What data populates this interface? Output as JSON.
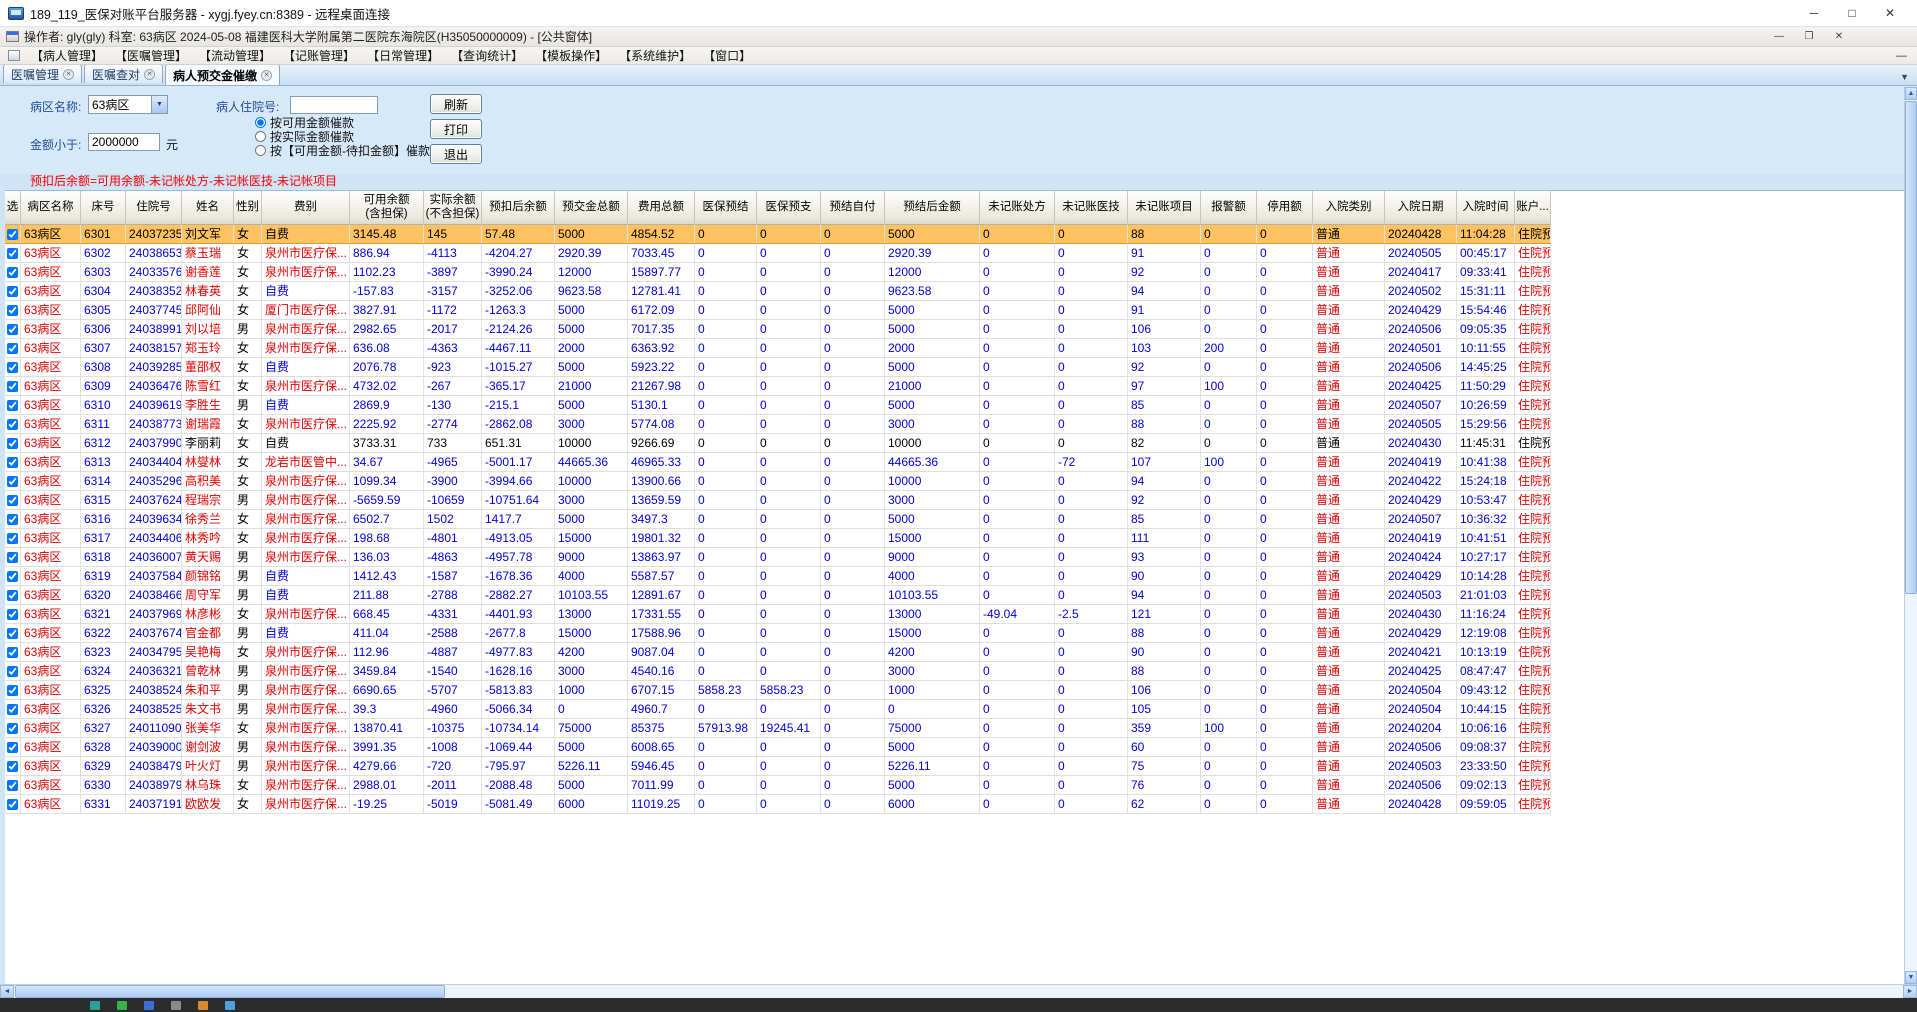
{
  "window": {
    "rdp_title": "189_119_医保对账平台服务器 - xygj.fyey.cn:8389 - 远程桌面连接",
    "app_title": "操作者: gly(gly)  科室: 63病区  2024-05-08  福建医科大学附属第二医院东海院区(H35050000009) - [公共窗体]"
  },
  "icons": {
    "minimize": "─",
    "maximize": "□",
    "close": "✕",
    "mdi_minimize": "—",
    "mdi_restore": "❐",
    "mdi_close": "✕",
    "dropdown_arrow": "▼",
    "tab_close": "✕",
    "tab_overflow": "▼",
    "scroll_up": "▲",
    "scroll_down": "▼",
    "scroll_left": "◄",
    "scroll_right": "►"
  },
  "menu": {
    "items": [
      "【病人管理】",
      "【医嘱管理】",
      "【流动管理】",
      "【记账管理】",
      "【日常管理】",
      "【查询统计】",
      "【模板操作】",
      "【系统维护】",
      "【窗口】"
    ]
  },
  "tabs": [
    {
      "label": "医嘱管理",
      "active": false
    },
    {
      "label": "医嘱查对",
      "active": false
    },
    {
      "label": "病人预交金催缴",
      "active": true
    }
  ],
  "filters": {
    "ward_label": "病区名称:",
    "ward_value": "63病区",
    "patient_label": "病人住院号:",
    "patient_value": "",
    "amount_label": "金额小于:",
    "amount_value": "2000000",
    "amount_unit": "元",
    "radios": [
      {
        "label": "按可用金额催款",
        "checked": true
      },
      {
        "label": "按实际金额催款",
        "checked": false
      },
      {
        "label": "按【可用金额-待扣金额】催款",
        "checked": false
      }
    ],
    "buttons": {
      "refresh": "刷新",
      "print": "打印",
      "exit": "退出"
    }
  },
  "note": "预扣后余额=可用余额-未记帐处方-未记帐医技-未记帐项目",
  "colors": {
    "selected_row": "#ffc261",
    "text_red": "#e10000",
    "text_blue": "#0000d8",
    "note_red": "#ff0000",
    "panel_blue": "#d6e9f8"
  },
  "table": {
    "selected_index": 0,
    "plain_rows": [
      11
    ],
    "columns": [
      {
        "label": "选"
      },
      {
        "label": "病区名称"
      },
      {
        "label": "床号"
      },
      {
        "label": "住院号"
      },
      {
        "label": "姓名"
      },
      {
        "label": "性别"
      },
      {
        "label": "费别"
      },
      {
        "label": "可用余额\n(含担保)"
      },
      {
        "label": "实际余额\n(不含担保)"
      },
      {
        "label": "预扣后余额"
      },
      {
        "label": "预交金总额"
      },
      {
        "label": "费用总额"
      },
      {
        "label": "医保预结"
      },
      {
        "label": "医保预支"
      },
      {
        "label": "预结自付"
      },
      {
        "label": "预结后金额"
      },
      {
        "label": "未记账处方"
      },
      {
        "label": "未记账医技"
      },
      {
        "label": "未记账项目"
      },
      {
        "label": "报警额"
      },
      {
        "label": "停用额"
      },
      {
        "label": "入院类别"
      },
      {
        "label": "入院日期"
      },
      {
        "label": "入院时间"
      },
      {
        "label": "账户..."
      }
    ],
    "rows": [
      [
        "63病区",
        "6301",
        "24037235",
        "刘文军",
        "女",
        "自费",
        "3145.48",
        "145",
        "57.48",
        "5000",
        "4854.52",
        "0",
        "0",
        "0",
        "5000",
        "0",
        "0",
        "88",
        "0",
        "0",
        "普通",
        "20240428",
        "11:04:28",
        "住院预"
      ],
      [
        "63病区",
        "6302",
        "24038653",
        "蔡玉瑞",
        "女",
        "泉州市医疗保...",
        "886.94",
        "-4113",
        "-4204.27",
        "2920.39",
        "7033.45",
        "0",
        "0",
        "0",
        "2920.39",
        "0",
        "0",
        "91",
        "0",
        "0",
        "普通",
        "20240505",
        "00:45:17",
        "住院预"
      ],
      [
        "63病区",
        "6303",
        "24033576",
        "谢香莲",
        "女",
        "泉州市医疗保...",
        "1102.23",
        "-3897",
        "-3990.24",
        "12000",
        "15897.77",
        "0",
        "0",
        "0",
        "12000",
        "0",
        "0",
        "92",
        "0",
        "0",
        "普通",
        "20240417",
        "09:33:41",
        "住院预"
      ],
      [
        "63病区",
        "6304",
        "24038352",
        "林春英",
        "女",
        "自费",
        "-157.83",
        "-3157",
        "-3252.06",
        "9623.58",
        "12781.41",
        "0",
        "0",
        "0",
        "9623.58",
        "0",
        "0",
        "94",
        "0",
        "0",
        "普通",
        "20240502",
        "15:31:11",
        "住院预"
      ],
      [
        "63病区",
        "6305",
        "24037745",
        "邱阿仙",
        "女",
        "厦门市医疗保...",
        "3827.91",
        "-1172",
        "-1263.3",
        "5000",
        "6172.09",
        "0",
        "0",
        "0",
        "5000",
        "0",
        "0",
        "91",
        "0",
        "0",
        "普通",
        "20240429",
        "15:54:46",
        "住院预"
      ],
      [
        "63病区",
        "6306",
        "24038991",
        "刘以培",
        "男",
        "泉州市医疗保...",
        "2982.65",
        "-2017",
        "-2124.26",
        "5000",
        "7017.35",
        "0",
        "0",
        "0",
        "5000",
        "0",
        "0",
        "106",
        "0",
        "0",
        "普通",
        "20240506",
        "09:05:35",
        "住院预"
      ],
      [
        "63病区",
        "6307",
        "24038157",
        "郑玉玲",
        "女",
        "泉州市医疗保...",
        "636.08",
        "-4363",
        "-4467.11",
        "2000",
        "6363.92",
        "0",
        "0",
        "0",
        "2000",
        "0",
        "0",
        "103",
        "200",
        "0",
        "普通",
        "20240501",
        "10:11:55",
        "住院预"
      ],
      [
        "63病区",
        "6308",
        "24039285",
        "董邵权",
        "女",
        "自费",
        "2076.78",
        "-923",
        "-1015.27",
        "5000",
        "5923.22",
        "0",
        "0",
        "0",
        "5000",
        "0",
        "0",
        "92",
        "0",
        "0",
        "普通",
        "20240506",
        "14:45:25",
        "住院预"
      ],
      [
        "63病区",
        "6309",
        "24036476",
        "陈雪红",
        "女",
        "泉州市医疗保...",
        "4732.02",
        "-267",
        "-365.17",
        "21000",
        "21267.98",
        "0",
        "0",
        "0",
        "21000",
        "0",
        "0",
        "97",
        "100",
        "0",
        "普通",
        "20240425",
        "11:50:29",
        "住院预"
      ],
      [
        "63病区",
        "6310",
        "24039619",
        "李胜生",
        "男",
        "自费",
        "2869.9",
        "-130",
        "-215.1",
        "5000",
        "5130.1",
        "0",
        "0",
        "0",
        "5000",
        "0",
        "0",
        "85",
        "0",
        "0",
        "普通",
        "20240507",
        "10:26:59",
        "住院预"
      ],
      [
        "63病区",
        "6311",
        "24038773",
        "谢瑞霞",
        "女",
        "泉州市医疗保...",
        "2225.92",
        "-2774",
        "-2862.08",
        "3000",
        "5774.08",
        "0",
        "0",
        "0",
        "3000",
        "0",
        "0",
        "88",
        "0",
        "0",
        "普通",
        "20240505",
        "15:29:56",
        "住院预"
      ],
      [
        "63病区",
        "6312",
        "24037990",
        "李丽莉",
        "女",
        "自费",
        "3733.31",
        "733",
        "651.31",
        "10000",
        "9266.69",
        "0",
        "0",
        "0",
        "10000",
        "0",
        "0",
        "82",
        "0",
        "0",
        "普通",
        "20240430",
        "11:45:31",
        "住院预"
      ],
      [
        "63病区",
        "6313",
        "24034404",
        "林燮林",
        "女",
        "龙岩市医管中...",
        "34.67",
        "-4965",
        "-5001.17",
        "44665.36",
        "46965.33",
        "0",
        "0",
        "0",
        "44665.36",
        "0",
        "-72",
        "107",
        "100",
        "0",
        "普通",
        "20240419",
        "10:41:38",
        "住院预"
      ],
      [
        "63病区",
        "6314",
        "24035296",
        "高积美",
        "女",
        "泉州市医疗保...",
        "1099.34",
        "-3900",
        "-3994.66",
        "10000",
        "13900.66",
        "0",
        "0",
        "0",
        "10000",
        "0",
        "0",
        "94",
        "0",
        "0",
        "普通",
        "20240422",
        "15:24:18",
        "住院预"
      ],
      [
        "63病区",
        "6315",
        "24037624",
        "程瑞宗",
        "男",
        "泉州市医疗保...",
        "-5659.59",
        "-10659",
        "-10751.64",
        "3000",
        "13659.59",
        "0",
        "0",
        "0",
        "3000",
        "0",
        "0",
        "92",
        "0",
        "0",
        "普通",
        "20240429",
        "10:53:47",
        "住院预"
      ],
      [
        "63病区",
        "6316",
        "24039634",
        "徐秀兰",
        "女",
        "泉州市医疗保...",
        "6502.7",
        "1502",
        "1417.7",
        "5000",
        "3497.3",
        "0",
        "0",
        "0",
        "5000",
        "0",
        "0",
        "85",
        "0",
        "0",
        "普通",
        "20240507",
        "10:36:32",
        "住院预"
      ],
      [
        "63病区",
        "6317",
        "24034406",
        "林秀吟",
        "女",
        "泉州市医疗保...",
        "198.68",
        "-4801",
        "-4913.05",
        "15000",
        "19801.32",
        "0",
        "0",
        "0",
        "15000",
        "0",
        "0",
        "111",
        "0",
        "0",
        "普通",
        "20240419",
        "10:41:51",
        "住院预"
      ],
      [
        "63病区",
        "6318",
        "24036007",
        "黄天赐",
        "男",
        "泉州市医疗保...",
        "136.03",
        "-4863",
        "-4957.78",
        "9000",
        "13863.97",
        "0",
        "0",
        "0",
        "9000",
        "0",
        "0",
        "93",
        "0",
        "0",
        "普通",
        "20240424",
        "10:27:17",
        "住院预"
      ],
      [
        "63病区",
        "6319",
        "24037584",
        "颜锦铭",
        "男",
        "自费",
        "1412.43",
        "-1587",
        "-1678.36",
        "4000",
        "5587.57",
        "0",
        "0",
        "0",
        "4000",
        "0",
        "0",
        "90",
        "0",
        "0",
        "普通",
        "20240429",
        "10:14:28",
        "住院预"
      ],
      [
        "63病区",
        "6320",
        "24038466",
        "周守军",
        "男",
        "自费",
        "211.88",
        "-2788",
        "-2882.27",
        "10103.55",
        "12891.67",
        "0",
        "0",
        "0",
        "10103.55",
        "0",
        "0",
        "94",
        "0",
        "0",
        "普通",
        "20240503",
        "21:01:03",
        "住院预"
      ],
      [
        "63病区",
        "6321",
        "24037969",
        "林彦彬",
        "女",
        "泉州市医疗保...",
        "668.45",
        "-4331",
        "-4401.93",
        "13000",
        "17331.55",
        "0",
        "0",
        "0",
        "13000",
        "-49.04",
        "-2.5",
        "121",
        "0",
        "0",
        "普通",
        "20240430",
        "11:16:24",
        "住院预"
      ],
      [
        "63病区",
        "6322",
        "24037674",
        "官金都",
        "男",
        "自费",
        "411.04",
        "-2588",
        "-2677.8",
        "15000",
        "17588.96",
        "0",
        "0",
        "0",
        "15000",
        "0",
        "0",
        "88",
        "0",
        "0",
        "普通",
        "20240429",
        "12:19:08",
        "住院预"
      ],
      [
        "63病区",
        "6323",
        "24034795",
        "吴艳梅",
        "女",
        "泉州市医疗保...",
        "112.96",
        "-4887",
        "-4977.83",
        "4200",
        "9087.04",
        "0",
        "0",
        "0",
        "4200",
        "0",
        "0",
        "90",
        "0",
        "0",
        "普通",
        "20240421",
        "10:13:19",
        "住院预"
      ],
      [
        "63病区",
        "6324",
        "24036321",
        "曾乾林",
        "男",
        "泉州市医疗保...",
        "3459.84",
        "-1540",
        "-1628.16",
        "3000",
        "4540.16",
        "0",
        "0",
        "0",
        "3000",
        "0",
        "0",
        "88",
        "0",
        "0",
        "普通",
        "20240425",
        "08:47:47",
        "住院预"
      ],
      [
        "63病区",
        "6325",
        "24038524",
        "朱和平",
        "男",
        "泉州市医疗保...",
        "6690.65",
        "-5707",
        "-5813.83",
        "1000",
        "6707.15",
        "5858.23",
        "5858.23",
        "0",
        "1000",
        "0",
        "0",
        "106",
        "0",
        "0",
        "普通",
        "20240504",
        "09:43:12",
        "住院预"
      ],
      [
        "63病区",
        "6326",
        "24038525",
        "朱文书",
        "男",
        "泉州市医疗保...",
        "39.3",
        "-4960",
        "-5066.34",
        "0",
        "4960.7",
        "0",
        "0",
        "0",
        "0",
        "0",
        "0",
        "105",
        "0",
        "0",
        "普通",
        "20240504",
        "10:44:15",
        "住院预"
      ],
      [
        "63病区",
        "6327",
        "24011090",
        "张美华",
        "女",
        "泉州市医疗保...",
        "13870.41",
        "-10375",
        "-10734.14",
        "75000",
        "85375",
        "57913.98",
        "19245.41",
        "0",
        "75000",
        "0",
        "0",
        "359",
        "100",
        "0",
        "普通",
        "20240204",
        "10:06:16",
        "住院预"
      ],
      [
        "63病区",
        "6328",
        "24039000",
        "谢剑波",
        "男",
        "泉州市医疗保...",
        "3991.35",
        "-1008",
        "-1069.44",
        "5000",
        "6008.65",
        "0",
        "0",
        "0",
        "5000",
        "0",
        "0",
        "60",
        "0",
        "0",
        "普通",
        "20240506",
        "09:08:37",
        "住院预"
      ],
      [
        "63病区",
        "6329",
        "24038479",
        "叶火灯",
        "男",
        "泉州市医疗保...",
        "4279.66",
        "-720",
        "-795.97",
        "5226.11",
        "5946.45",
        "0",
        "0",
        "0",
        "5226.11",
        "0",
        "0",
        "75",
        "0",
        "0",
        "普通",
        "20240503",
        "23:33:50",
        "住院预"
      ],
      [
        "63病区",
        "6330",
        "24038979",
        "林乌珠",
        "女",
        "泉州市医疗保...",
        "2988.01",
        "-2011",
        "-2088.48",
        "5000",
        "7011.99",
        "0",
        "0",
        "0",
        "5000",
        "0",
        "0",
        "76",
        "0",
        "0",
        "普通",
        "20240506",
        "09:02:13",
        "住院预"
      ],
      [
        "63病区",
        "6331",
        "24037191",
        "欧欧发",
        "女",
        "泉州市医疗保...",
        "-19.25",
        "-5019",
        "-5081.49",
        "6000",
        "11019.25",
        "0",
        "0",
        "0",
        "6000",
        "0",
        "0",
        "62",
        "0",
        "0",
        "普通",
        "20240428",
        "09:59:05",
        "住院预"
      ]
    ]
  }
}
